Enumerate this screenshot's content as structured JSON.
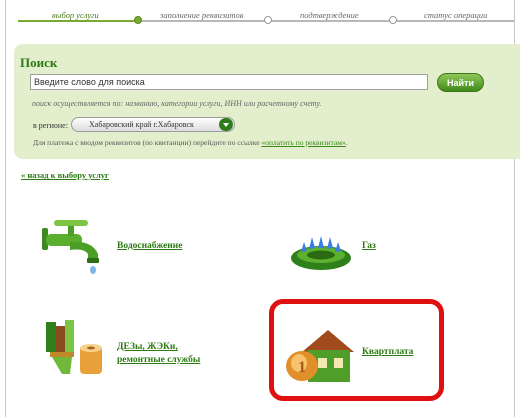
{
  "steps": [
    {
      "label": "выбор услуги",
      "active": true
    },
    {
      "label": "заполнение реквизитов",
      "active": false
    },
    {
      "label": "подтверждение",
      "active": false
    },
    {
      "label": "статус операции",
      "active": false
    }
  ],
  "search": {
    "title": "Поиск",
    "input_value": "Введите слово для поиска",
    "button_label": "Найти",
    "hint": "поиск осуществляется по: названию, категории услуги, ИНН или расчетному счету.",
    "region_label": "в регионе:",
    "region_value": "Хабаровский край г.Хабаровск",
    "req_text": "Для платежа с вводом реквизитов (по квитанции) перейдите по ссылке",
    "req_link": "«оплатить по реквизитам»",
    "req_end": "."
  },
  "back_link": "« назад к выбору услуг",
  "services": {
    "water": "Водоснабжение",
    "gas": "Газ",
    "dez_line1": "ДЕЗы, ЖЭКи,",
    "dez_line2": "ремонтные службы",
    "rent": "Квартплата"
  },
  "colors": {
    "accent": "#2c7a12",
    "panel": "#e3eecd",
    "highlight": "#e01010"
  }
}
